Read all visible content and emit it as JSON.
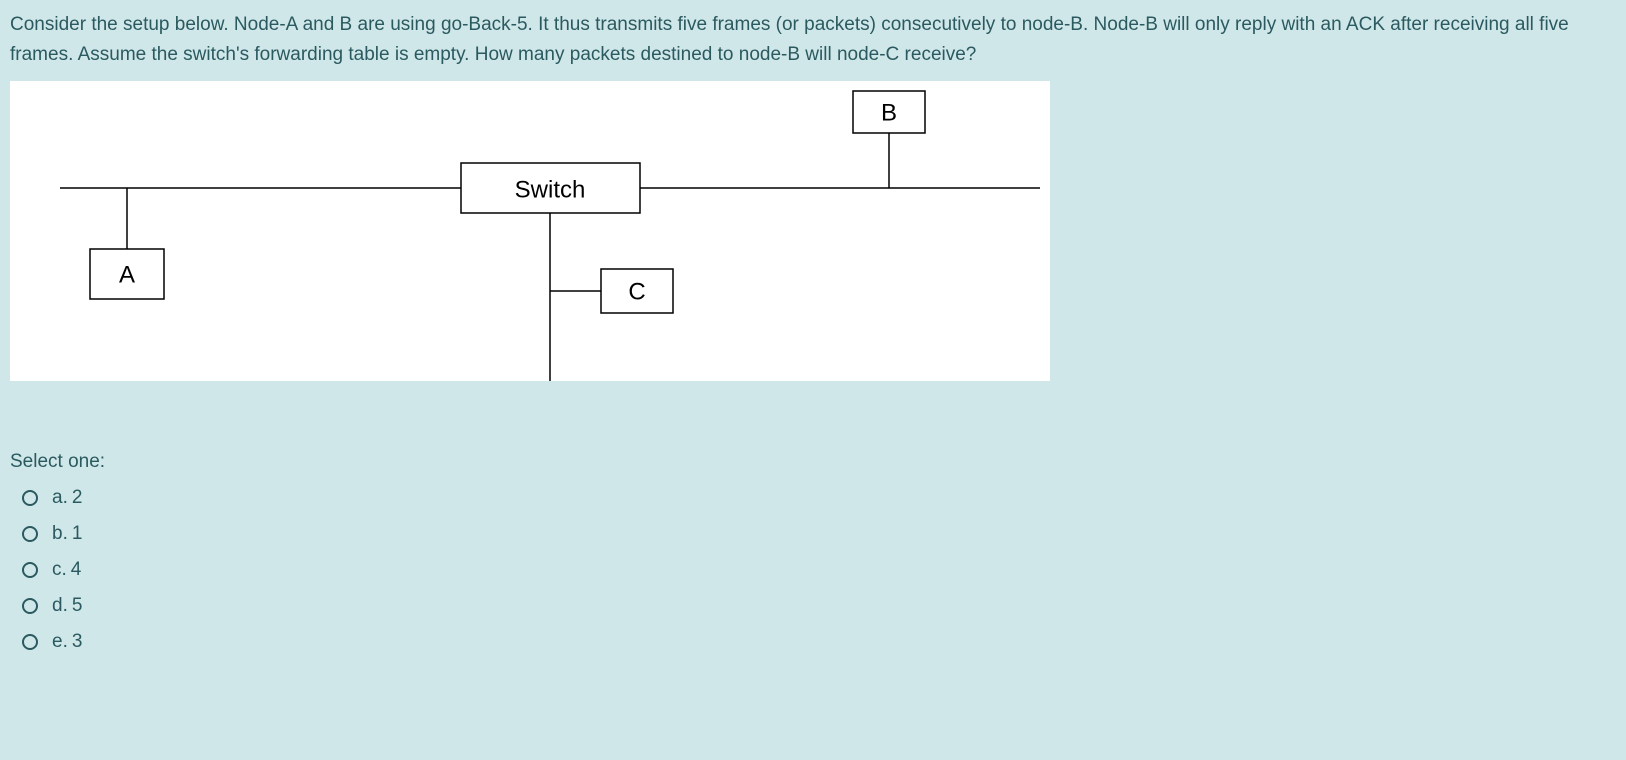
{
  "question": "Consider the setup below.  Node-A and B are using go-Back-5.  It thus transmits five frames (or packets) consecutively to node-B.   Node-B will only reply with an ACK after receiving all five frames.  Assume the switch's forwarding table is empty.  How many packets destined to node-B will node-C receive?",
  "diagram": {
    "node_a": "A",
    "node_b": "B",
    "node_c": "C",
    "switch_label": "Switch"
  },
  "select_label": "Select one:",
  "options": [
    {
      "letter": "a.",
      "value": "2"
    },
    {
      "letter": "b.",
      "value": "1"
    },
    {
      "letter": "c.",
      "value": "4"
    },
    {
      "letter": "d.",
      "value": "5"
    },
    {
      "letter": "e.",
      "value": "3"
    }
  ]
}
